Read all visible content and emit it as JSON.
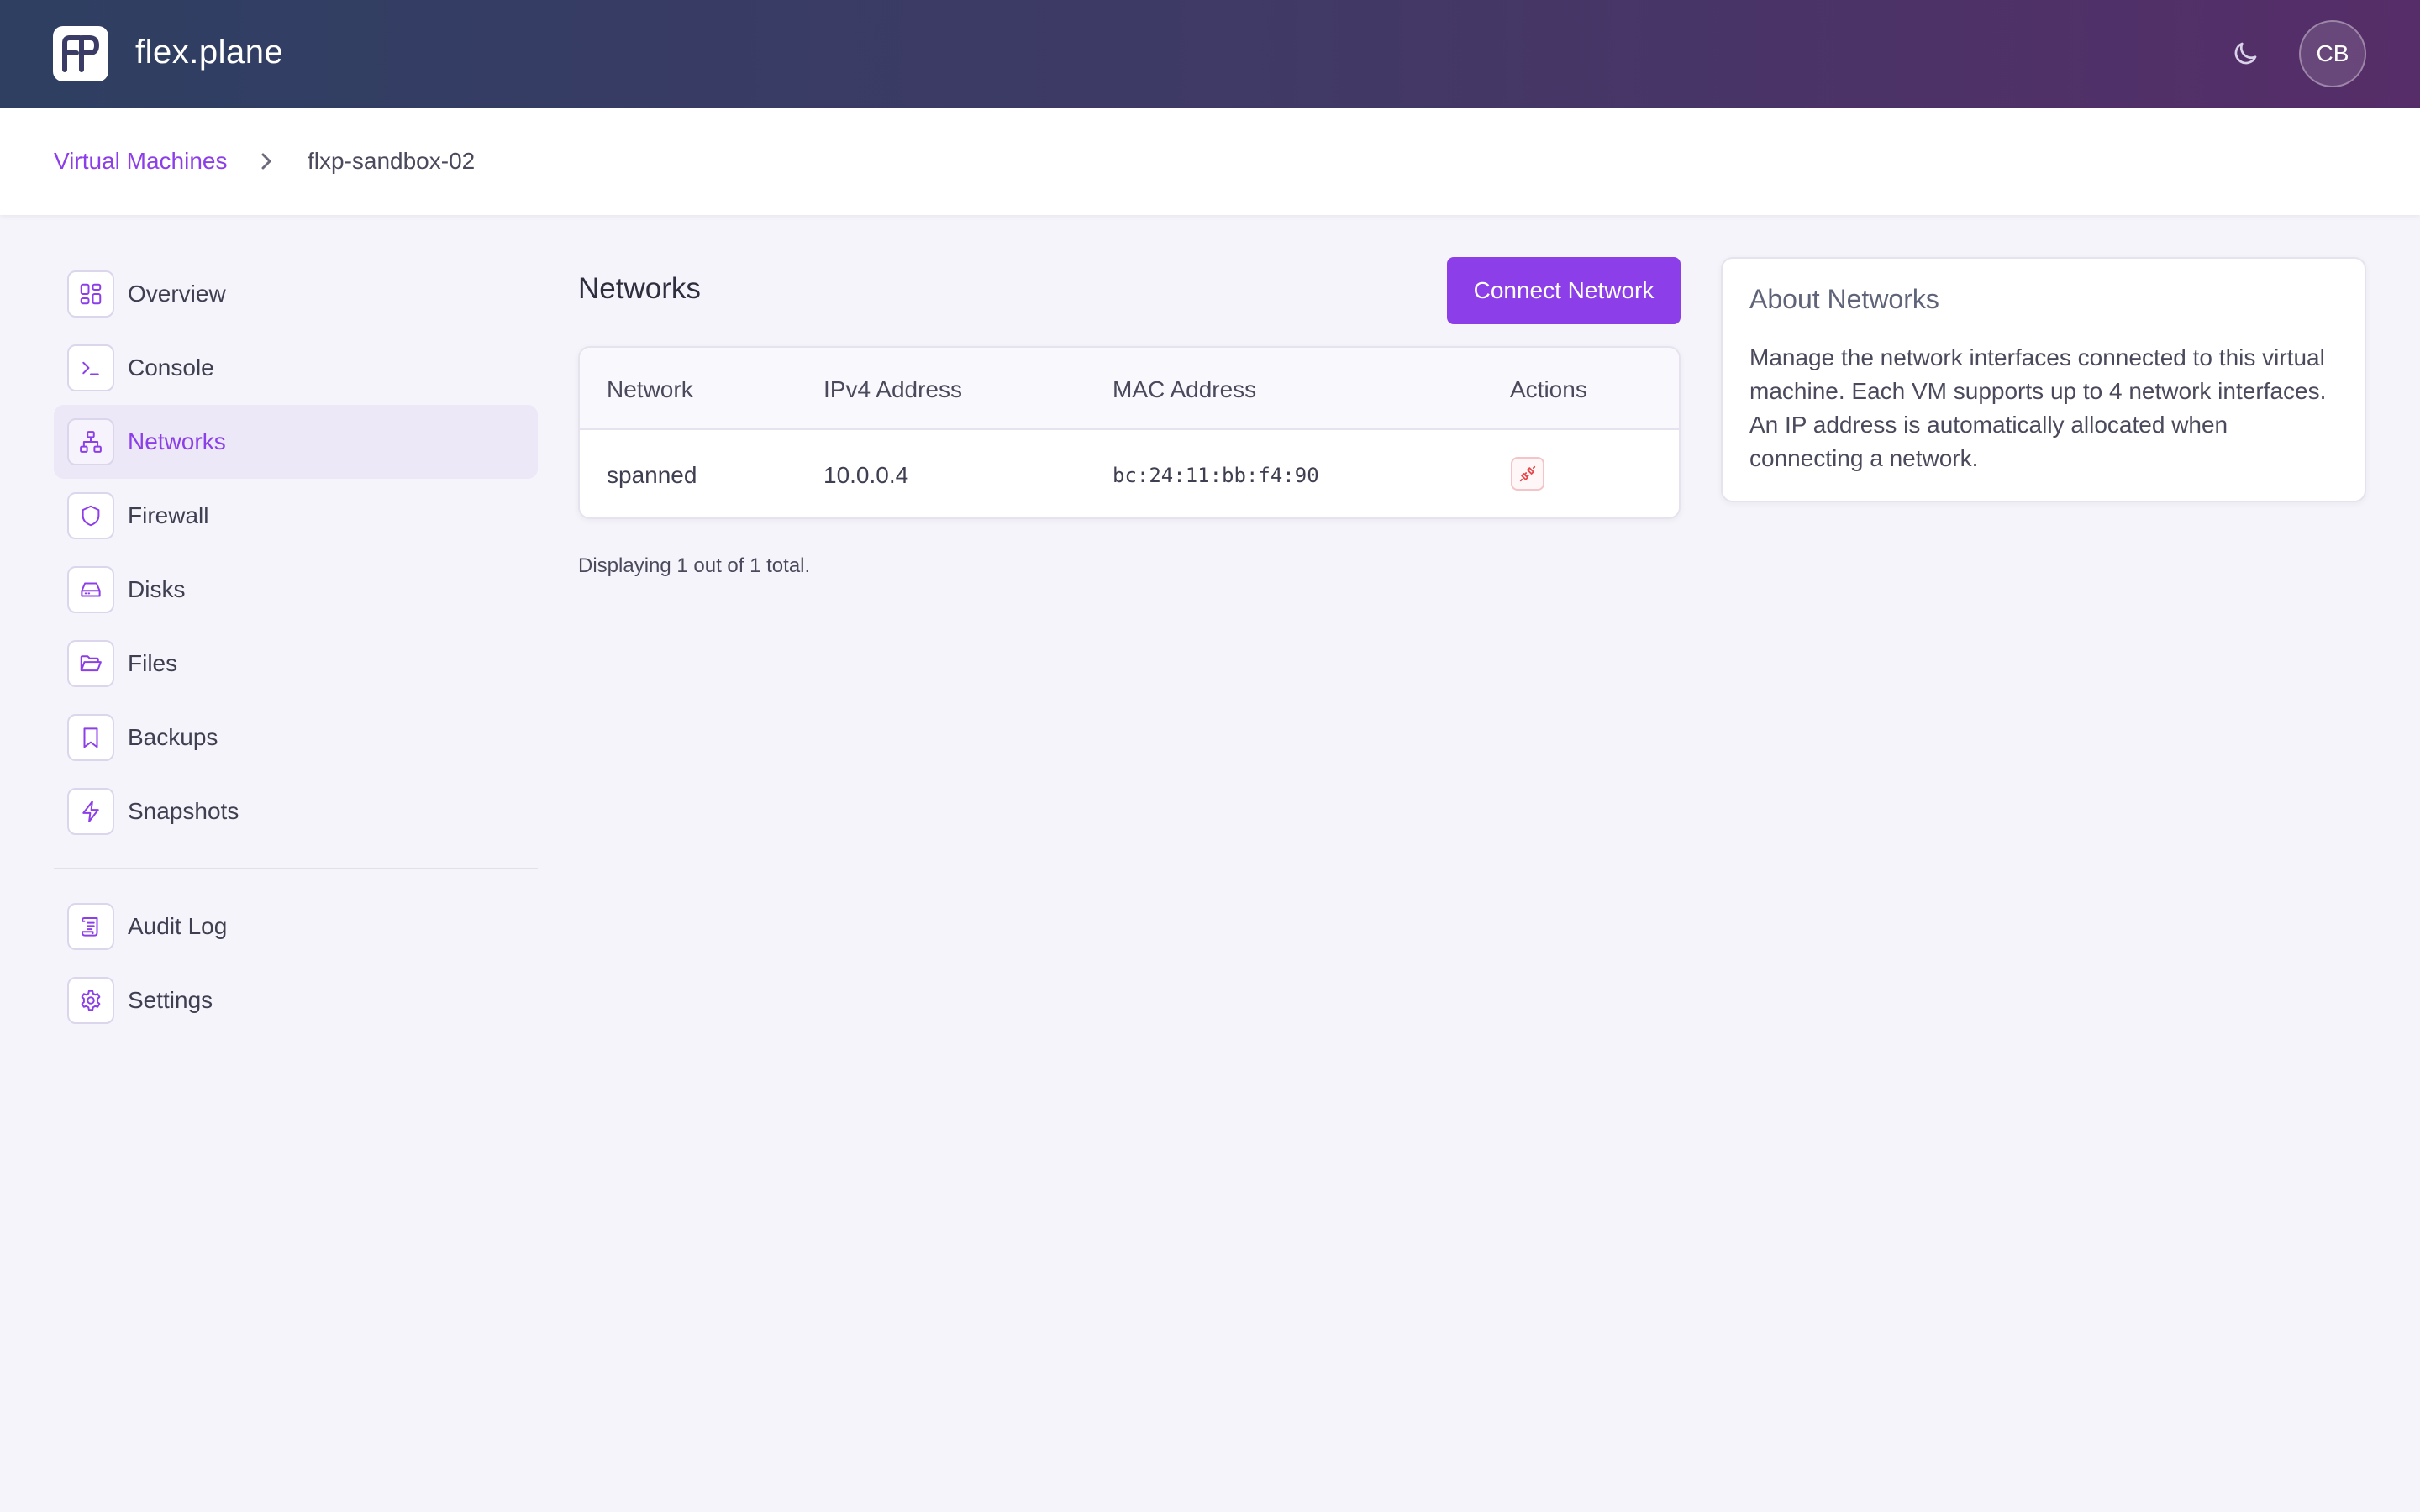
{
  "app": {
    "brand": "flex.plane"
  },
  "header": {
    "user_initials": "CB"
  },
  "breadcrumb": {
    "parent": "Virtual Machines",
    "current": "flxp-sandbox-02"
  },
  "sidebar": {
    "items": [
      {
        "label": "Overview",
        "icon": "grid-icon"
      },
      {
        "label": "Console",
        "icon": "terminal-icon"
      },
      {
        "label": "Networks",
        "icon": "network-icon",
        "active": true
      },
      {
        "label": "Firewall",
        "icon": "shield-icon"
      },
      {
        "label": "Disks",
        "icon": "drive-icon"
      },
      {
        "label": "Files",
        "icon": "folder-icon"
      },
      {
        "label": "Backups",
        "icon": "bookmark-icon"
      },
      {
        "label": "Snapshots",
        "icon": "bolt-icon"
      }
    ],
    "secondary": [
      {
        "label": "Audit Log",
        "icon": "scroll-icon"
      },
      {
        "label": "Settings",
        "icon": "gear-icon"
      }
    ]
  },
  "main": {
    "title": "Networks",
    "connect_label": "Connect Network",
    "table": {
      "headers": [
        "Network",
        "IPv4 Address",
        "MAC Address",
        "Actions"
      ],
      "rows": [
        {
          "network": "spanned",
          "ipv4": "10.0.0.4",
          "mac": "bc:24:11:bb:f4:90",
          "action_icon": "disconnect-icon"
        }
      ]
    },
    "footer": "Displaying 1 out of 1 total."
  },
  "about": {
    "title": "About Networks",
    "body": "Manage the network interfaces connected to this virtual machine. Each VM supports up to 4 network interfaces. An IP address is automatically allocated when connecting a network."
  },
  "colors": {
    "accent": "#8c3fe8",
    "danger": "#e5484d",
    "header_gradient_start": "#2e3f62",
    "header_gradient_end": "#562d68"
  }
}
